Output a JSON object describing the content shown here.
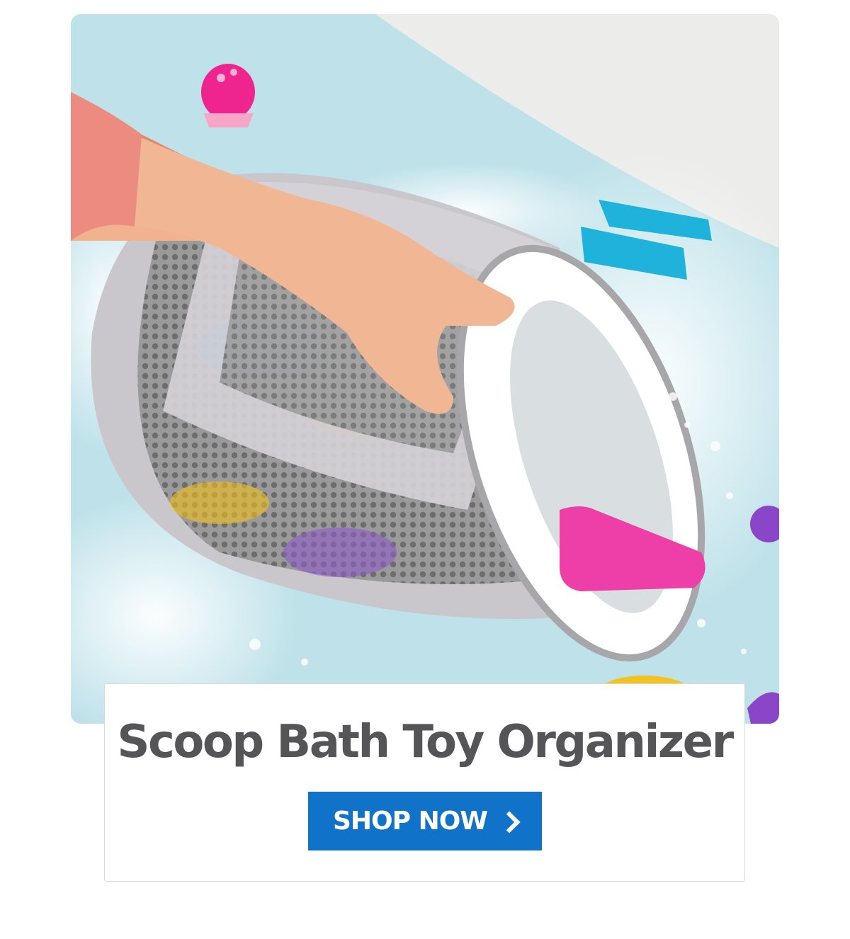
{
  "product": {
    "title": "Scoop Bath Toy Organizer",
    "image_alt": "Hand holding a mesh scoop bath toy organizer in a bubbly bathtub with foam letter toys"
  },
  "cta": {
    "label": "SHOP NOW",
    "icon": "chevron-right-icon"
  },
  "colors": {
    "title": "#555558",
    "button_bg": "#1172c9",
    "button_text": "#ffffff",
    "water": "#bfe2ea"
  }
}
